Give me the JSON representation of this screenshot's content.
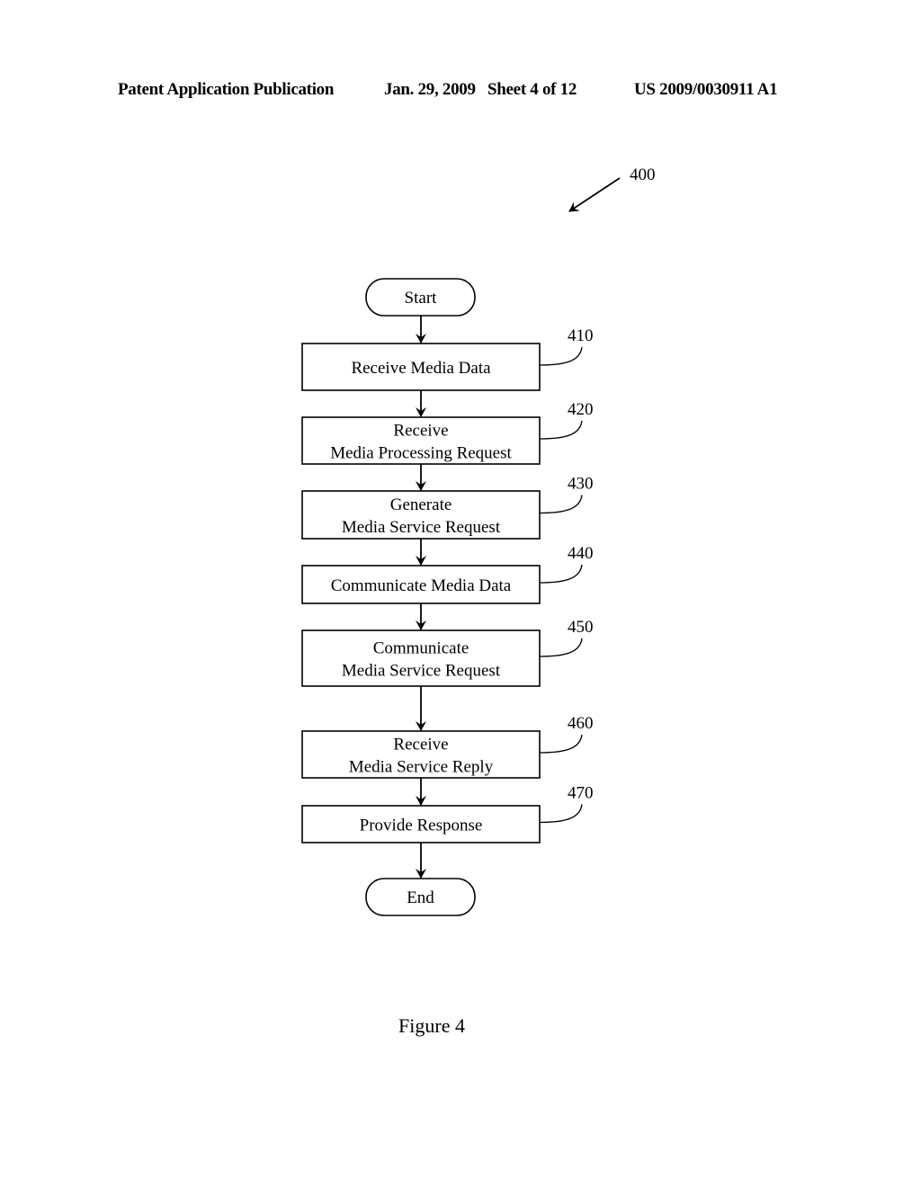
{
  "header": {
    "publication": "Patent Application Publication",
    "date_sheet": "Jan. 29, 2009   Sheet 4 of 12",
    "patent_number": "US 2009/0030911 A1"
  },
  "diagram": {
    "reference": "400",
    "start_label": "Start",
    "end_label": "End",
    "steps": [
      {
        "id": "410",
        "lines": [
          "Receive Media Data"
        ]
      },
      {
        "id": "420",
        "lines": [
          "Receive",
          "Media Processing Request"
        ]
      },
      {
        "id": "430",
        "lines": [
          "Generate",
          "Media Service Request"
        ]
      },
      {
        "id": "440",
        "lines": [
          "Communicate Media Data"
        ]
      },
      {
        "id": "450",
        "lines": [
          "Communicate",
          "Media Service Request"
        ]
      },
      {
        "id": "460",
        "lines": [
          "Receive",
          "Media Service Reply"
        ]
      },
      {
        "id": "470",
        "lines": [
          "Provide Response"
        ]
      }
    ]
  },
  "figure_caption": "Figure 4"
}
